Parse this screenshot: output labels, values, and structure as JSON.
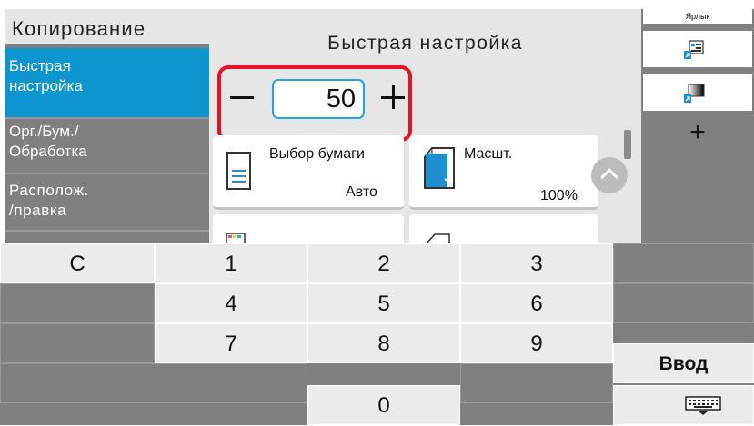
{
  "sidebar": {
    "title": "Копирование",
    "items": [
      {
        "line1": "Быстрая",
        "line2": "настройка",
        "active": true
      },
      {
        "line1": "Орг./Бум./",
        "line2": "Обработка",
        "active": false
      },
      {
        "line1": "Располож.",
        "line2": "/правка",
        "active": false
      }
    ]
  },
  "main": {
    "title": "Быстрая настройка",
    "copies": {
      "value": "50",
      "minus_icon": "minus-icon",
      "plus_icon": "plus-icon"
    },
    "buttons": {
      "paper": {
        "label": "Выбор бумаги",
        "value": "Авто",
        "icon": "paper-tray-icon"
      },
      "zoom": {
        "label": "Масшт.",
        "value": "100%",
        "icon": "zoom-icon"
      },
      "color": {
        "icon": "color-select-icon"
      },
      "duplex": {
        "icon": "duplex-icon"
      }
    },
    "scroll_icon": "chevron-up-icon"
  },
  "shortcut_panel": {
    "title": "Ярлык",
    "items": [
      {
        "icon": "shortcut-image-icon"
      },
      {
        "icon": "shortcut-density-icon"
      }
    ],
    "add_label": "+"
  },
  "keypad": {
    "clear": "C",
    "digits": [
      "1",
      "2",
      "3",
      "4",
      "5",
      "6",
      "7",
      "8",
      "9",
      "0"
    ],
    "enter": "Ввод",
    "keyboard_icon": "keyboard-icon"
  },
  "colors": {
    "accent": "#0d95cf",
    "highlight": "#e8102a",
    "panel_gray": "#808080",
    "key_light": "#ebebeb"
  }
}
